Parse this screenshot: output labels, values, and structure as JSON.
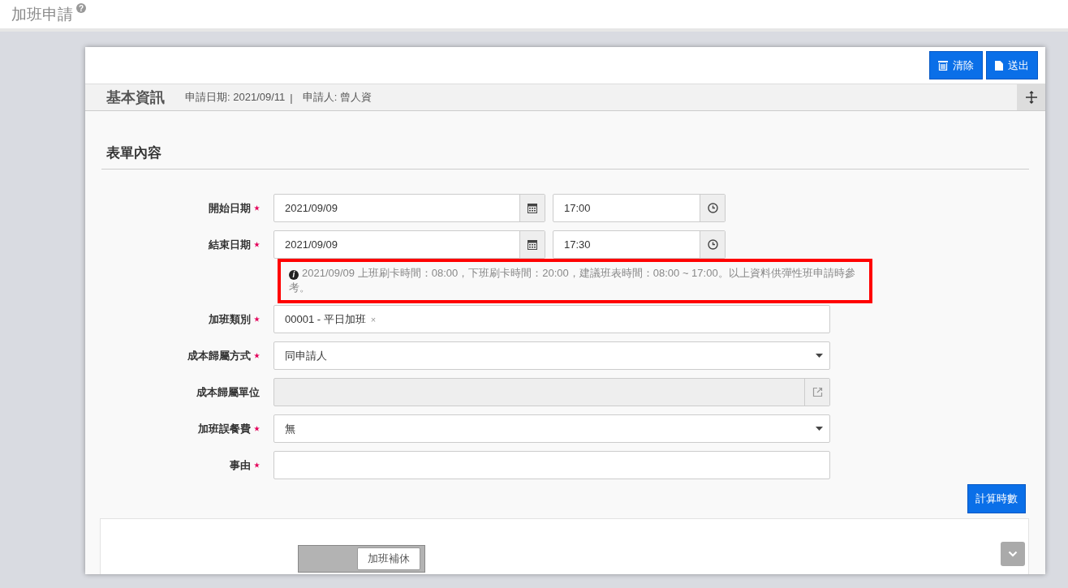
{
  "page": {
    "title": "加班申請",
    "help": "?"
  },
  "toolbar": {
    "buttons": [
      {
        "kind": "clear",
        "label": "清除"
      },
      {
        "kind": "submit",
        "label": "送出"
      }
    ]
  },
  "basic_info": {
    "title": "基本資訊",
    "apply_date": "申請日期: 2021/09/11",
    "separator": "|",
    "applicant": "申請人: 曾人資"
  },
  "form": {
    "title": "表單內容",
    "rows": [
      {
        "kind": "datetime",
        "label": "開始日期",
        "required": true,
        "date": "2021/09/09",
        "time": "17:00"
      },
      {
        "kind": "datetime",
        "label": "結束日期",
        "required": true,
        "date": "2021/09/09",
        "time": "17:30"
      },
      {
        "kind": "note",
        "text": "2021/09/09 上班刷卡時間：08:00，下班刷卡時間：20:00，建議班表時間：08:00 ~ 17:00。以上資料供彈性班申請時參考。",
        "highlighted": true,
        "icon": "i"
      },
      {
        "kind": "tag",
        "label": "加班類別",
        "required": true,
        "value": "00001 - 平日加班",
        "remove": "×"
      },
      {
        "kind": "select",
        "label": "成本歸屬方式",
        "required": true,
        "value": "同申請人"
      },
      {
        "kind": "lookup",
        "label": "成本歸屬單位",
        "required": false,
        "disabled": true
      },
      {
        "kind": "select",
        "label": "加班誤餐費",
        "required": true,
        "value": "無"
      },
      {
        "kind": "text",
        "label": "事由",
        "required": true,
        "value": ""
      }
    ],
    "calc_button": "計算時數"
  },
  "comp_card": {
    "toggle": {
      "label": "加班補休",
      "on": false
    }
  }
}
